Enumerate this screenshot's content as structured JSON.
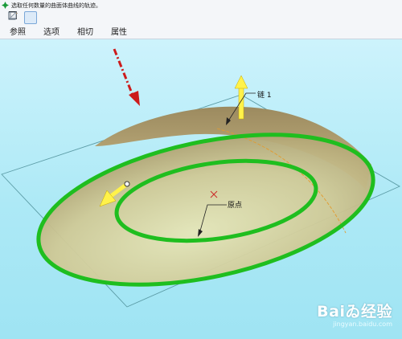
{
  "prompt": {
    "text": "选取任何数量的曲面体曲线的轨迹。"
  },
  "tabs": [
    {
      "label": "参照"
    },
    {
      "label": "选项"
    },
    {
      "label": "相切"
    },
    {
      "label": "属性"
    }
  ],
  "tools": [
    "surface-boundary-icon",
    "blend-surface-icon",
    "edit-icon",
    "triangle-tool-icon",
    "corner-tool-icon"
  ],
  "viewport": {
    "labels": {
      "chain": "链 1",
      "origin": "原点"
    }
  },
  "watermark": {
    "brand": "Baiゐ经验",
    "url": "jingyan.baidu.com"
  },
  "colors": {
    "curve": "#1fbe1f",
    "surface": "#c8c58c",
    "arrow": "#ffee33",
    "pointer": "#cc1b1b",
    "background": "#b5ecf7"
  }
}
